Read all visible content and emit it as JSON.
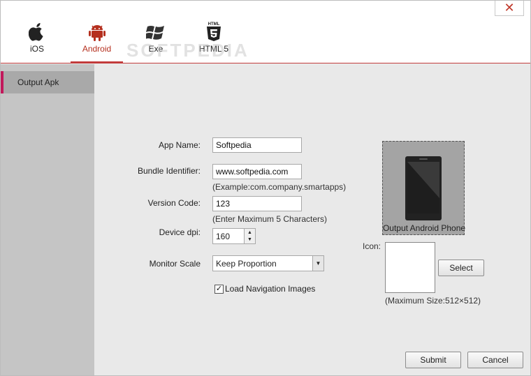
{
  "window": {
    "close_glyph": "✕"
  },
  "tabs": [
    {
      "label": "iOS",
      "icon": "apple-icon"
    },
    {
      "label": "Android",
      "icon": "android-icon",
      "active": true
    },
    {
      "label": "Exe",
      "icon": "windows-icon"
    },
    {
      "label": "HTML 5",
      "icon": "html5-icon",
      "icon_text": "HTML"
    }
  ],
  "watermark": "SOFTPEDIA",
  "sidebar": {
    "items": [
      {
        "label": "Output Apk",
        "active": true
      }
    ]
  },
  "form": {
    "app_name_label": "App Name:",
    "app_name_value": "Softpedia",
    "bundle_label": "Bundle Identifier:",
    "bundle_value": "www.softpedia.com",
    "bundle_hint": "(Example:com.company.smartapps)",
    "version_label": "Version Code:",
    "version_value": "123",
    "version_hint": "(Enter Maximum 5 Characters)",
    "dpi_label": "Device dpi:",
    "dpi_value": "160",
    "scale_label": "Monitor Scale",
    "scale_value": "Keep Proportion",
    "nav_images_label": "Load Navigation Images",
    "nav_images_checked": true
  },
  "preview": {
    "phone_caption": "Output Android Phone",
    "icon_label": "Icon:",
    "select_label": "Select",
    "max_size": "(Maximum Size:512×512)"
  },
  "actions": {
    "submit_label": "Submit",
    "cancel_label": "Cancel"
  },
  "colors": {
    "accent": "#c23b3b",
    "sidebar_marker": "#c2185b",
    "android_green": "#b5301f"
  }
}
